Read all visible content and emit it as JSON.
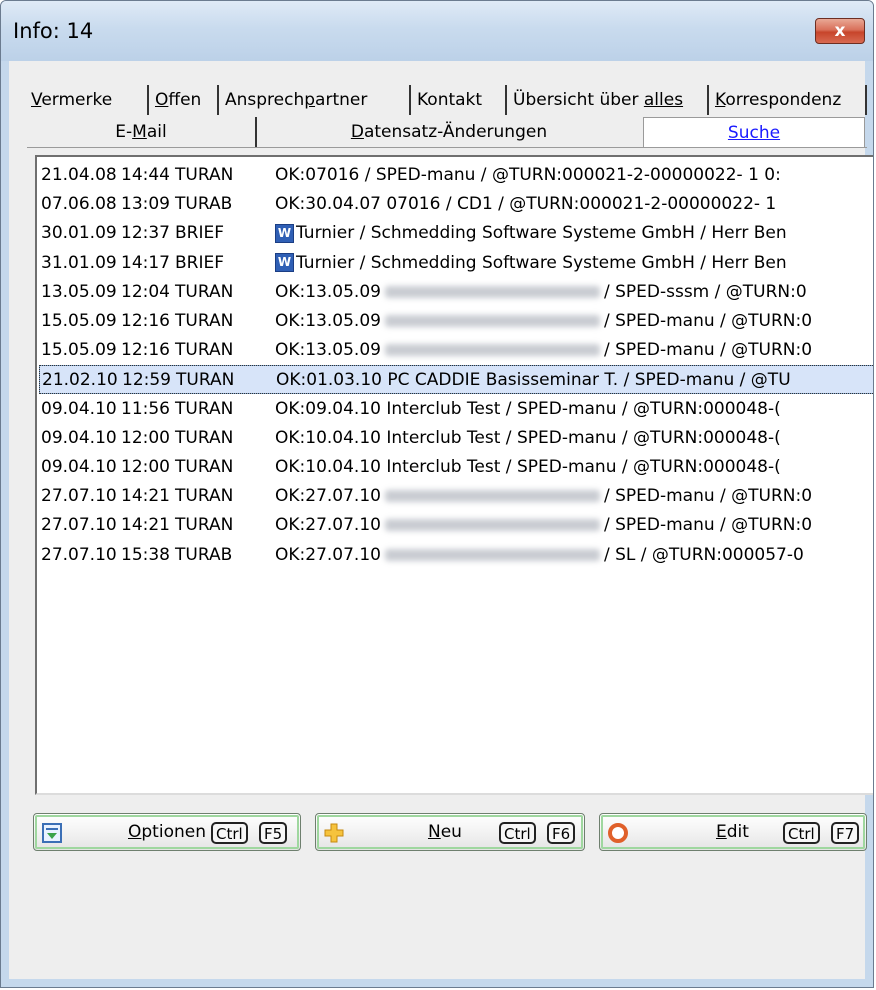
{
  "window": {
    "title": "Info: 14",
    "close_label": "x"
  },
  "tabs_row1": [
    {
      "label": "Vermerke",
      "mn": "V",
      "rest": "ermerke"
    },
    {
      "label": "Offen",
      "mn": "O",
      "rest": "ffen"
    },
    {
      "label": "Ansprechpartner",
      "pre": "Ansprech",
      "mn": "p",
      "rest": "artner"
    },
    {
      "label": "Kontakt"
    },
    {
      "label": "Übersicht über alles",
      "pre": "Übersicht über ",
      "mn": "alles"
    },
    {
      "label": "Korrespondenz",
      "mn": "K",
      "rest": "orrespondenz"
    }
  ],
  "tabs_row2": [
    {
      "label": "E-Mail",
      "pre": "E-",
      "mn": "M",
      "rest": "ail"
    },
    {
      "label": "Datensatz-Änderungen",
      "mn": "D",
      "rest": "atensatz-Änderungen"
    },
    {
      "label": "Suche",
      "active": true
    }
  ],
  "rows": [
    {
      "date": "21.04.08",
      "time": "14:44",
      "type": "TURAN",
      "text": "OK:07016 / SPED-manu / @TURN:000021-2-00000022- 1  0:"
    },
    {
      "date": "07.06.08",
      "time": "13:09",
      "type": "TURAB",
      "text": "OK:30.04.07 07016 / CD1 / @TURN:000021-2-00000022- 1"
    },
    {
      "date": "30.01.09",
      "time": "12:37",
      "type": "BRIEF",
      "icon": "word-doc-icon",
      "text": "Turnier / Schmedding Software Systeme GmbH / Herr Ben"
    },
    {
      "date": "31.01.09",
      "time": "14:17",
      "type": "BRIEF",
      "icon": "word-doc-icon",
      "text": "Turnier / Schmedding Software Systeme GmbH / Herr Ben"
    },
    {
      "date": "13.05.09",
      "time": "12:04",
      "type": "TURAN",
      "text": "OK:13.05.09",
      "tail": "/ SPED-sssm / @TURN:0"
    },
    {
      "date": "15.05.09",
      "time": "12:16",
      "type": "TURAN",
      "text": "OK:13.05.09",
      "tail": "/ SPED-manu / @TURN:0"
    },
    {
      "date": "15.05.09",
      "time": "12:16",
      "type": "TURAN",
      "text": "OK:13.05.09",
      "tail": "/ SPED-manu / @TURN:0"
    },
    {
      "date": "21.02.10",
      "time": "12:59",
      "type": "TURAN",
      "text": "OK:01.03.10 PC CADDIE Basisseminar T. / SPED-manu / @TU",
      "selected": true
    },
    {
      "date": "09.04.10",
      "time": "11:56",
      "type": "TURAN",
      "text": "OK:09.04.10 Interclub Test / SPED-manu / @TURN:000048-("
    },
    {
      "date": "09.04.10",
      "time": "12:00",
      "type": "TURAN",
      "text": "OK:10.04.10 Interclub Test / SPED-manu / @TURN:000048-("
    },
    {
      "date": "09.04.10",
      "time": "12:00",
      "type": "TURAN",
      "text": "OK:10.04.10 Interclub Test / SPED-manu / @TURN:000048-("
    },
    {
      "date": "27.07.10",
      "time": "14:21",
      "type": "TURAN",
      "text": "OK:27.07.10",
      "tail": "/ SPED-manu / @TURN:0"
    },
    {
      "date": "27.07.10",
      "time": "14:21",
      "type": "TURAN",
      "text": "OK:27.07.10",
      "tail": "/ SPED-manu / @TURN:0"
    },
    {
      "date": "27.07.10",
      "time": "15:38",
      "type": "TURAB",
      "text": "OK:27.07.10",
      "tail": "/ SL / @TURN:000057-0"
    }
  ],
  "buttons": [
    {
      "label": "Optionen",
      "mn": "O",
      "rest": "ptionen",
      "key1": "Ctrl",
      "key2": "F5",
      "icon": "options-icon"
    },
    {
      "label": "Neu",
      "mn": "N",
      "rest": "eu",
      "key1": "Ctrl",
      "key2": "F6",
      "icon": "plus-icon"
    },
    {
      "label": "Edit",
      "mn": "E",
      "rest": "dit",
      "key1": "Ctrl",
      "key2": "F7",
      "icon": "edit-circle-icon"
    }
  ]
}
